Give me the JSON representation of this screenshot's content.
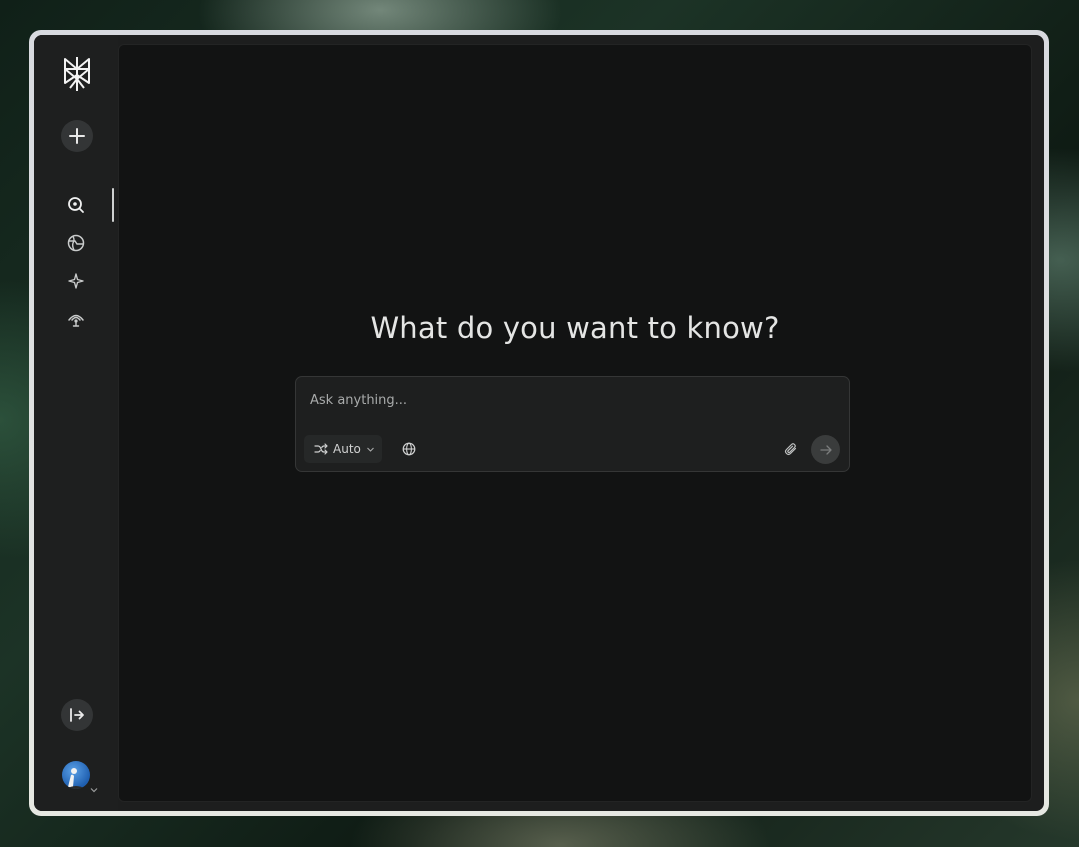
{
  "colors": {
    "sidebar_bg": "#1e1f1f",
    "main_bg": "#121313",
    "frame": "#e0e2dc",
    "text": "#e4e5e4",
    "muted": "#a9abab"
  },
  "sidebar": {
    "logo_icon": "perplexity-logo-icon",
    "new_thread_icon": "plus-icon",
    "items": [
      {
        "icon": "search-icon",
        "active": true
      },
      {
        "icon": "globe-icon",
        "active": false
      },
      {
        "icon": "sparkle-icon",
        "active": false
      },
      {
        "icon": "signal-icon",
        "active": false
      }
    ],
    "collapse_icon": "expand-sidebar-icon",
    "avatar_icon": "user-avatar"
  },
  "main": {
    "headline": "What do you want to know?",
    "search": {
      "placeholder": "Ask anything...",
      "value": "",
      "mode_label": "Auto",
      "mode_icon": "shuffle-icon",
      "source_icon": "globe-icon",
      "attach_icon": "paperclip-icon",
      "submit_icon": "arrow-right-icon"
    }
  }
}
